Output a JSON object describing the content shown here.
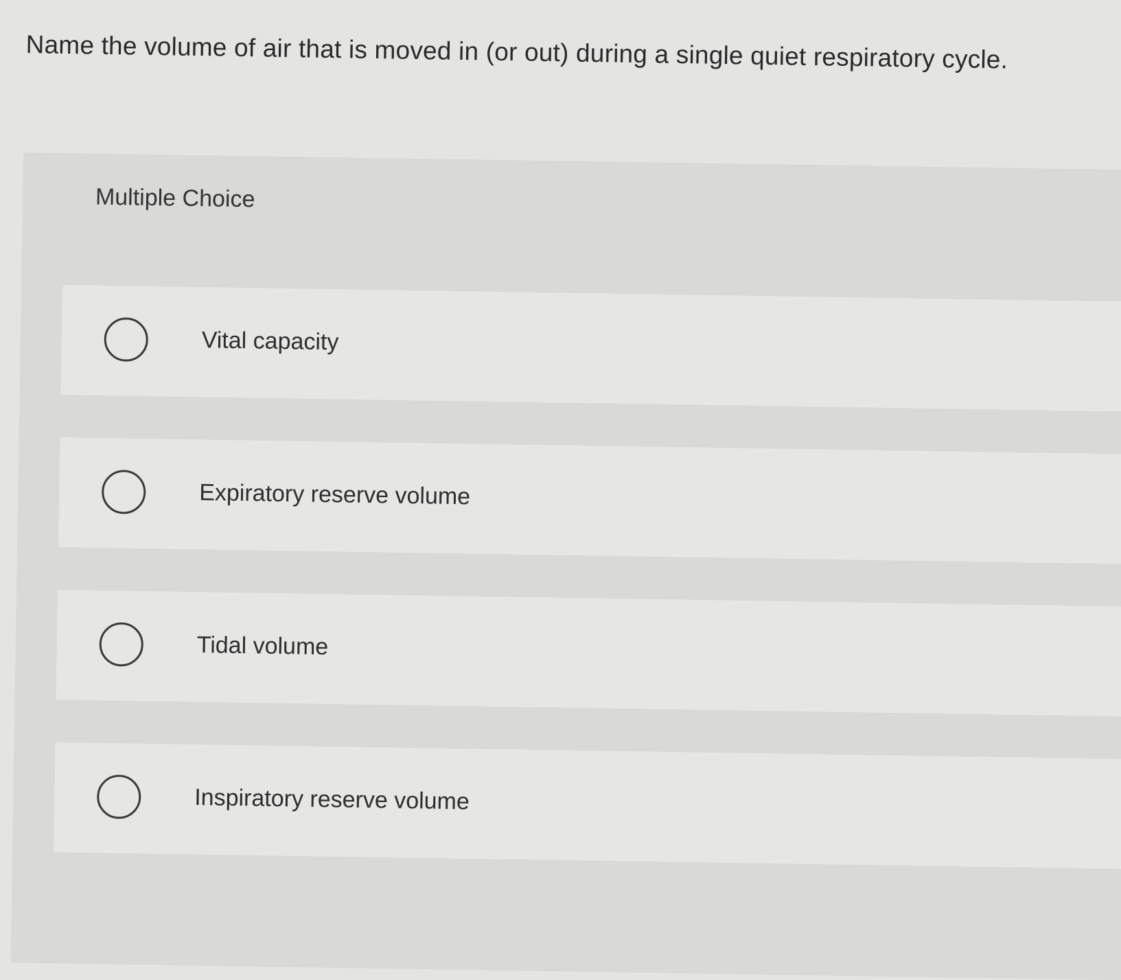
{
  "question": {
    "text": "Name the volume of air that is moved in (or out) during a single quiet respiratory cycle."
  },
  "quiz": {
    "type_label": "Multiple Choice",
    "options": [
      {
        "label": "Vital capacity",
        "selected": false
      },
      {
        "label": "Expiratory reserve volume",
        "selected": false
      },
      {
        "label": "Tidal volume",
        "selected": false
      },
      {
        "label": "Inspiratory reserve volume",
        "selected": false
      }
    ]
  },
  "colors": {
    "background": "#e4e4e2",
    "panel": "#d9d9d7",
    "option_row": "#e6e6e4",
    "text": "#2a2a2a",
    "radio_border": "#3a3a3a"
  },
  "icons": {
    "radio": "radio-unchecked-icon"
  }
}
